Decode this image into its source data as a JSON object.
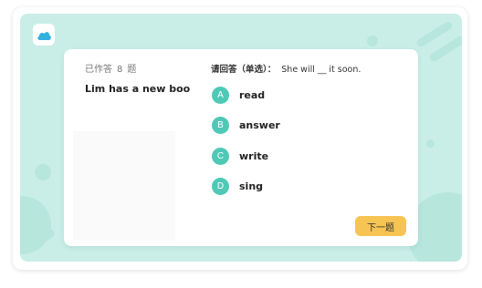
{
  "progress": {
    "prefix": "已作答",
    "count": "8",
    "suffix": "题"
  },
  "passage": {
    "text": "Lim has a new boo"
  },
  "question": {
    "label": "请回答（单选）：",
    "sentence": "She will __ it soon."
  },
  "options": [
    {
      "letter": "A",
      "text": "read"
    },
    {
      "letter": "B",
      "text": "answer"
    },
    {
      "letter": "C",
      "text": "write"
    },
    {
      "letter": "D",
      "text": "sing"
    }
  ],
  "next_button": {
    "label": "下一题"
  },
  "logo": {
    "icon": "cloud-icon"
  },
  "colors": {
    "background": "#c9eee7",
    "option_accent": "#4ec9b6",
    "next_button": "#f6c452"
  }
}
